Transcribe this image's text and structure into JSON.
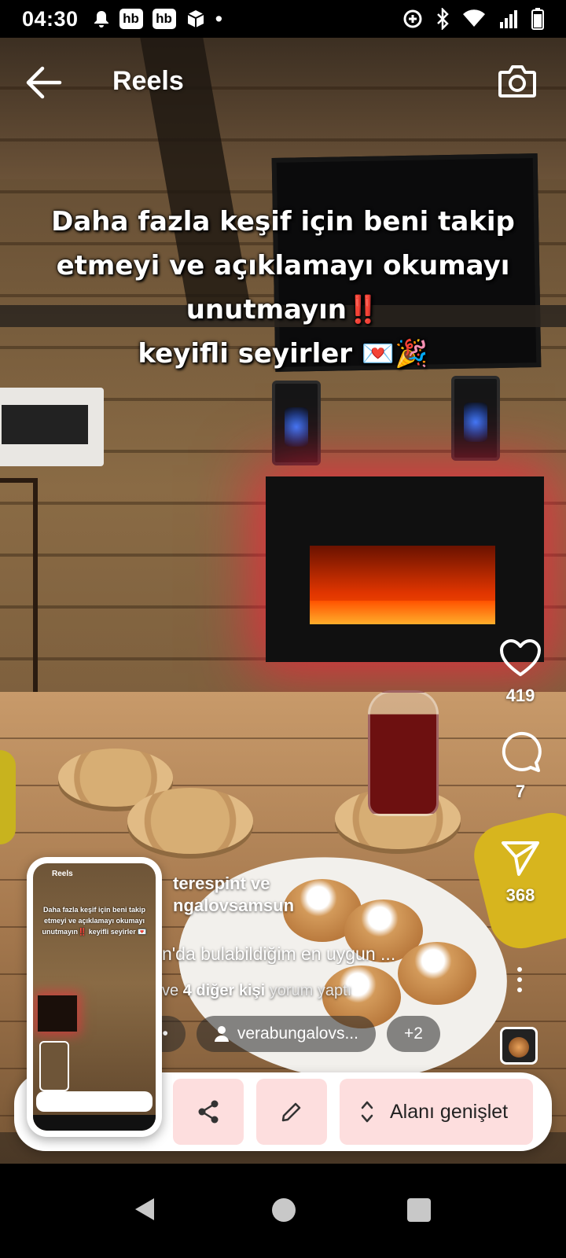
{
  "status_bar": {
    "time": "04:30",
    "badges": [
      "hb",
      "hb"
    ],
    "dot": "•"
  },
  "header": {
    "title": "Reels"
  },
  "caption": {
    "line1": "Daha fazla keşif için beni takip",
    "line2": "etmeyi ve açıklamayı okumayı",
    "line3": "unutmayın‼️",
    "line4": "keyifli seyirler 💌🎉"
  },
  "actions": {
    "likes": "419",
    "comments": "7",
    "shares": "368"
  },
  "post": {
    "author_line1": "teresp​int ve",
    "author_line2": "ngalovsamsun",
    "description": "n'da bulabildiğim en uygun ...",
    "comments_prefix": "ve",
    "comments_bold": "4 diğer kişi",
    "comments_suffix": "yorum yaptı",
    "chip_audio": "ar •",
    "chip_person": "verabungalovs...",
    "chip_more": "+2"
  },
  "toolbar": {
    "expand_label": "Alanı genişlet"
  },
  "preview": {
    "title": "Reels",
    "caption": "Daha fazla keşif için beni takip etmeyi ve açıklamayı okumayı unutmayın‼️ keyifli seyirler 💌"
  },
  "colors": {
    "toolbar_button_bg": "#fddede",
    "background": "#000000",
    "text": "#ffffff"
  },
  "icons": {
    "back": "arrow-left-icon",
    "camera": "camera-icon",
    "like": "heart-icon",
    "comment": "comment-icon",
    "share": "send-icon",
    "more": "more-vertical-icon",
    "share_screenshot": "share-icon",
    "edit": "pencil-icon",
    "expand": "expand-icon"
  }
}
